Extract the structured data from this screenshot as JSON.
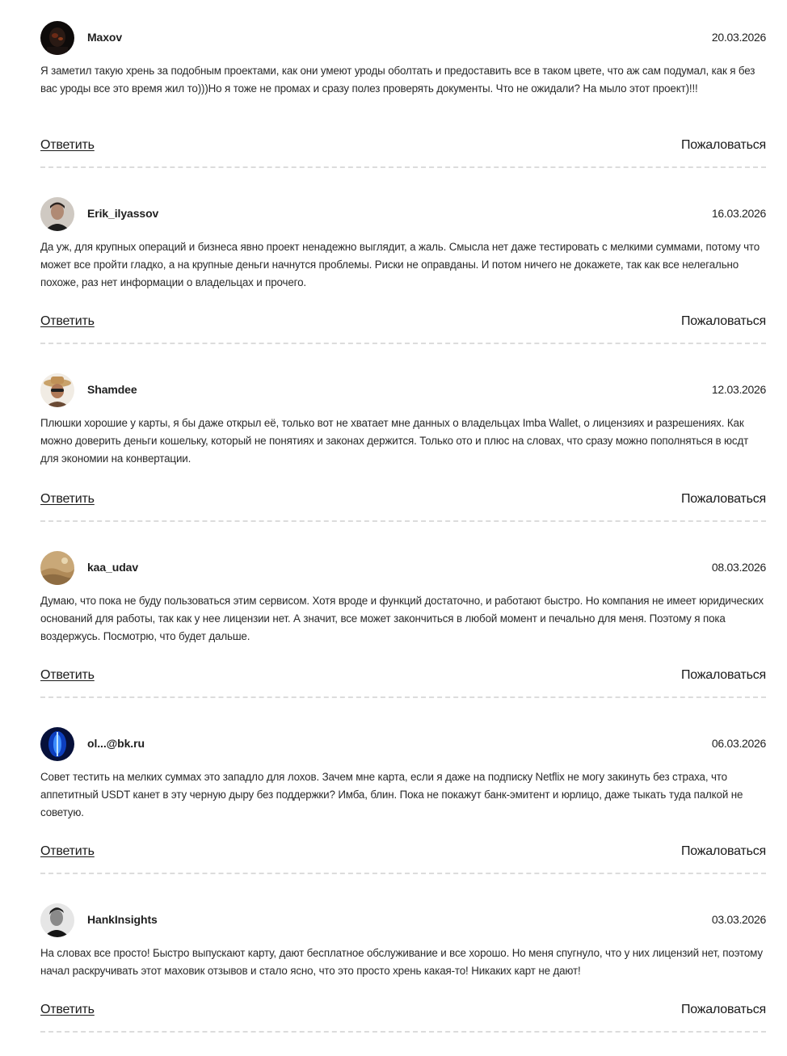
{
  "reply_label": "Ответить",
  "report_label": "Пожаловаться",
  "comments": [
    {
      "author": "Maxov",
      "date": "20.03.2026",
      "text": "Я заметил такую хрень за подобным проектами, как они умеют уроды оболтать и предоставить все в таком цвете, что аж сам подумал, как я без вас уроды все это время жил то)))Но я тоже не промах и сразу полез проверять документы. Что не ожидали? На мыло этот проект)!!!",
      "avatar_icon": "avatar-dark-portrait"
    },
    {
      "author": "Erik_ilyassov",
      "date": "16.03.2026",
      "text": "Да уж, для крупных операций и бизнеса явно проект ненадежно выглядит, а жаль. Смысла нет даже тестировать с мелкими суммами, потому что может все пройти гладко, а на крупные деньги начнутся проблемы. Риски не оправданы. И потом ничего не докажете, так как все нелегально похоже, раз нет информации о владельцах и прочего.",
      "avatar_icon": "avatar-man-portrait"
    },
    {
      "author": "Shamdee",
      "date": "12.03.2026",
      "text": "Плюшки хорошие у карты, я бы даже открыл её, только вот не хватает мне данных о владельцах Imba Wallet, о лицензиях и разрешениях. Как можно доверить деньги кошельку, который не понятиях и законах держится. Только ото и плюс на словах, что сразу можно пополняться в юсдт для экономии на конвертации.",
      "avatar_icon": "avatar-man-hat"
    },
    {
      "author": "kaa_udav",
      "date": "08.03.2026",
      "text": "Думаю, что пока не буду пользоваться этим сервисом. Хотя вроде и функций достаточно, и работают быстро. Но компания не имеет юридических оснований для работы, так как у нее лицензии нет. А значит, все может закончиться в любой момент и печально для меня. Поэтому я пока воздержусь. Посмотрю, что будет дальше.",
      "avatar_icon": "avatar-sand-landscape"
    },
    {
      "author": "ol...@bk.ru",
      "date": "06.03.2026",
      "text": "Совет тестить на мелких суммах это западло для лохов. Зачем мне карта, если я даже на подписку Netflix не могу закинуть без страха, что аппетитный USDT канет в эту черную дыру без поддержки? Имба, блин. Пока не покажут банк-эмитент и юрлицо, даже тыкать туда палкой не советую.",
      "avatar_icon": "avatar-blue-light"
    },
    {
      "author": "HankInsights",
      "date": "03.03.2026",
      "text": "На словах все просто! Быстро выпускают карту, дают бесплатное обслуживание и все хорошо. Но меня спугнуло, что у них лицензий нет, поэтому начал раскручивать этот маховик отзывов и стало ясно, что это просто хрень какая-то! Никаких карт не дают!",
      "avatar_icon": "avatar-bw-portrait"
    }
  ]
}
